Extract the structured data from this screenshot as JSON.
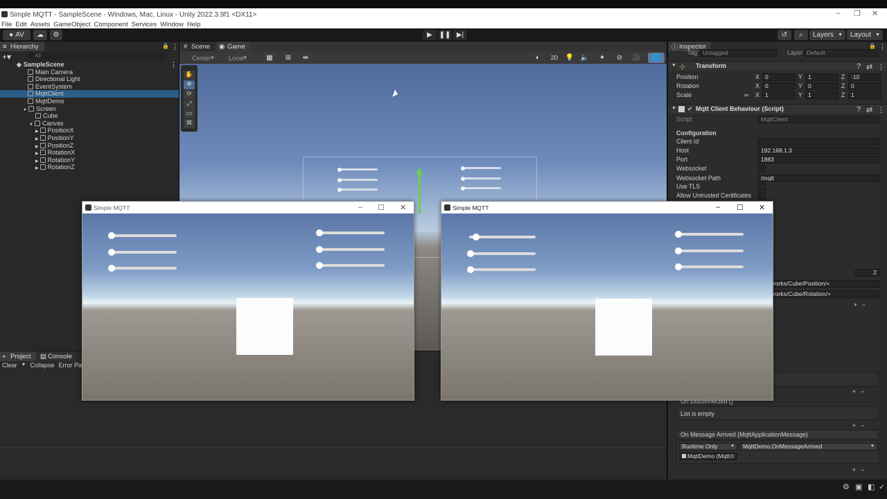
{
  "window": {
    "title": "Simple MQTT - SampleScene - Windows, Mac, Linux - Unity 2022.3.9f1 <DX11>"
  },
  "menu": [
    "File",
    "Edit",
    "Assets",
    "GameObject",
    "Component",
    "Services",
    "Window",
    "Help"
  ],
  "toolbar": {
    "account": "AV",
    "layers": "Layers",
    "layout": "Layout"
  },
  "hierarchy": {
    "tab": "Hierarchy",
    "search_placeholder": "All",
    "scene": "SampleScene",
    "items": [
      "Main Camera",
      "Directional Light",
      "EventSystem",
      "MqttClient",
      "MqttDemo",
      "Screen",
      "Cube",
      "Canvas",
      "PositionX",
      "PositionY",
      "PositionZ",
      "RotationX",
      "RotationY",
      "RotationZ"
    ],
    "selected": "MqttClient"
  },
  "scene_view": {
    "tabs": [
      "Scene",
      "Game"
    ],
    "pivot": "Center",
    "space": "Local",
    "mode_2d": "2D"
  },
  "bottom_panel": {
    "tabs": [
      "Project",
      "Console"
    ],
    "console_buttons": [
      "Clear",
      "Collapse",
      "Error Paus"
    ]
  },
  "inspector": {
    "tab": "Inspector",
    "tag_label": "Tag",
    "tag_value": "Untagged",
    "layer_label": "Layer",
    "layer_value": "Default",
    "transform": {
      "title": "Transform",
      "position": {
        "label": "Position",
        "x": "0",
        "y": "1",
        "z": "-10"
      },
      "rotation": {
        "label": "Rotation",
        "x": "0",
        "y": "0",
        "z": "0"
      },
      "scale": {
        "label": "Scale",
        "x": "1",
        "y": "1",
        "z": "1"
      }
    },
    "script_component": {
      "title": "Mqtt Client Behaviour (Script)",
      "script_label": "Script",
      "script_value": "MqttClient",
      "section": "Configuration",
      "fields": [
        {
          "label": "Client Id",
          "value": ""
        },
        {
          "label": "Host",
          "value": "192.168.1.3"
        },
        {
          "label": "Port",
          "value": "1883"
        },
        {
          "label": "Websocket",
          "value": ""
        },
        {
          "label": "Websocket Path",
          "value": "/mqtt"
        },
        {
          "label": "Use TLS",
          "value": ""
        },
        {
          "label": "Allow Untrusted Certificates",
          "value": ""
        }
      ],
      "topics_count": "2",
      "topics": [
        "rorks/Cube/Position/+",
        "rorks/Cube/Rotation/+"
      ]
    },
    "events": {
      "on_disconnected": "On Disconnected ()",
      "list_empty": "List is empty",
      "on_message": "On Message Arrived (MqttApplicationMessage)",
      "runtime": "Runtime Only",
      "handler": "MqttDemo.OnMessageArrived",
      "target": "MqttDemo (Mqtt"
    }
  },
  "player_windows": [
    {
      "title": "Simple MQTT",
      "left_sliders": [
        0.0,
        0.0,
        0.0
      ],
      "right_sliders": [
        0.0,
        0.0,
        0.0
      ]
    },
    {
      "title": "Simple MQTT",
      "left_sliders": [
        0.08,
        0.0,
        0.0
      ],
      "right_sliders": [
        0.0,
        0.0,
        0.0
      ]
    }
  ],
  "colors": {
    "selection": "#2c5d87",
    "panel": "#282828",
    "accent_gizmo": "#6ad14a"
  }
}
